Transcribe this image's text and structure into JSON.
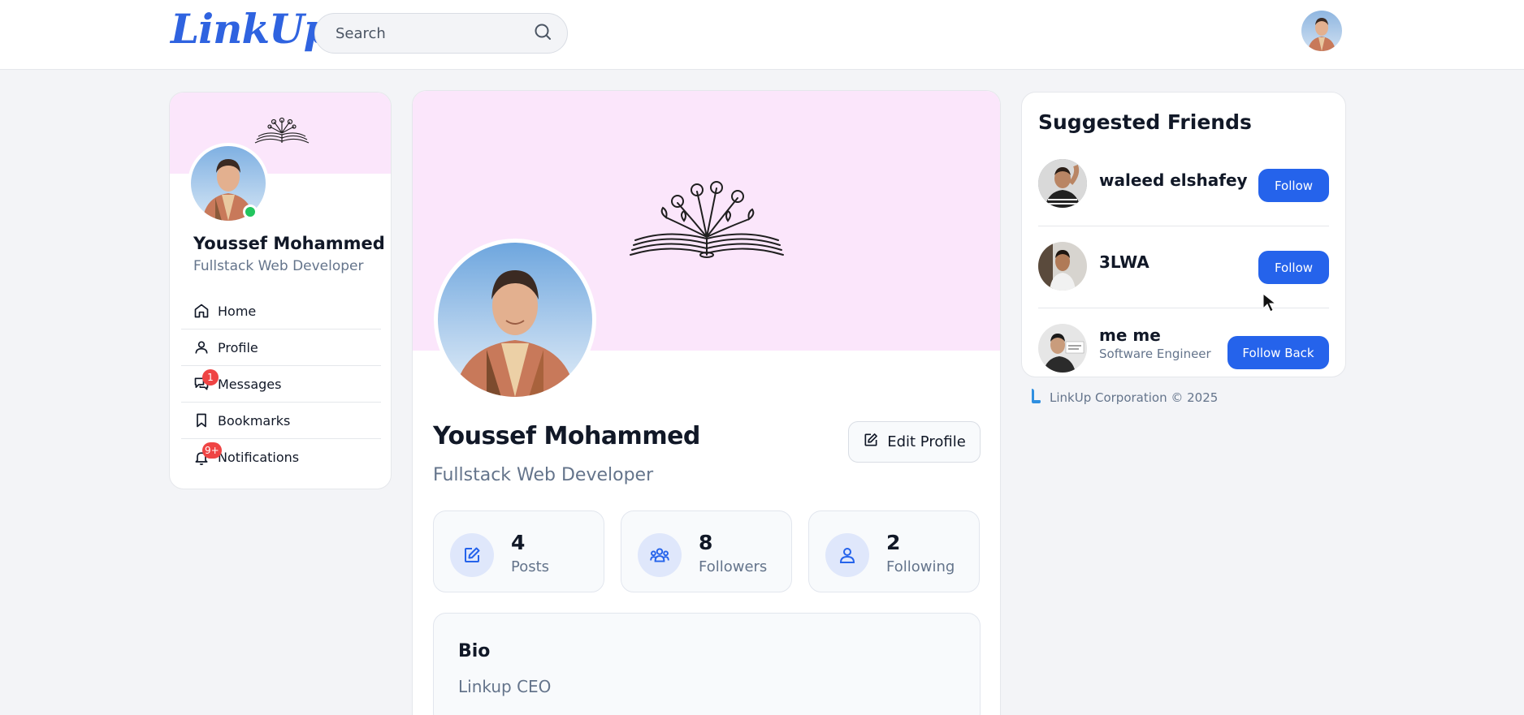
{
  "header": {
    "logo": "LinkUp",
    "search_placeholder": "Search"
  },
  "sidebar": {
    "name": "Youssef Mohammed",
    "title": "Fullstack Web Developer",
    "items": [
      {
        "label": "Home",
        "icon": "home-icon"
      },
      {
        "label": "Profile",
        "icon": "user-icon"
      },
      {
        "label": "Messages",
        "icon": "messages-icon",
        "badge": "1"
      },
      {
        "label": "Bookmarks",
        "icon": "bookmark-icon"
      },
      {
        "label": "Notifications",
        "icon": "bell-icon",
        "badge": "9+"
      }
    ]
  },
  "profile": {
    "name": "Youssef Mohammed",
    "title": "Fullstack Web Developer",
    "edit_label": "Edit Profile",
    "stats": [
      {
        "value": "4",
        "label": "Posts",
        "icon": "edit-icon"
      },
      {
        "value": "8",
        "label": "Followers",
        "icon": "group-icon"
      },
      {
        "value": "2",
        "label": "Following",
        "icon": "user-icon"
      }
    ],
    "bio_heading": "Bio",
    "bio_text": "Linkup CEO"
  },
  "suggested": {
    "heading": "Suggested Friends",
    "friends": [
      {
        "name": "waleed elshafey",
        "subtitle": "",
        "button": "Follow"
      },
      {
        "name": "3LWA",
        "subtitle": "",
        "button": "Follow"
      },
      {
        "name": "me me",
        "subtitle": "Software Engineer",
        "button": "Follow Back"
      }
    ]
  },
  "footer": {
    "text": "LinkUp Corporation © 2025"
  },
  "colors": {
    "accent": "#2563eb",
    "cover": "#fbe6fb",
    "badge": "#ef4444",
    "online": "#22c55e"
  }
}
